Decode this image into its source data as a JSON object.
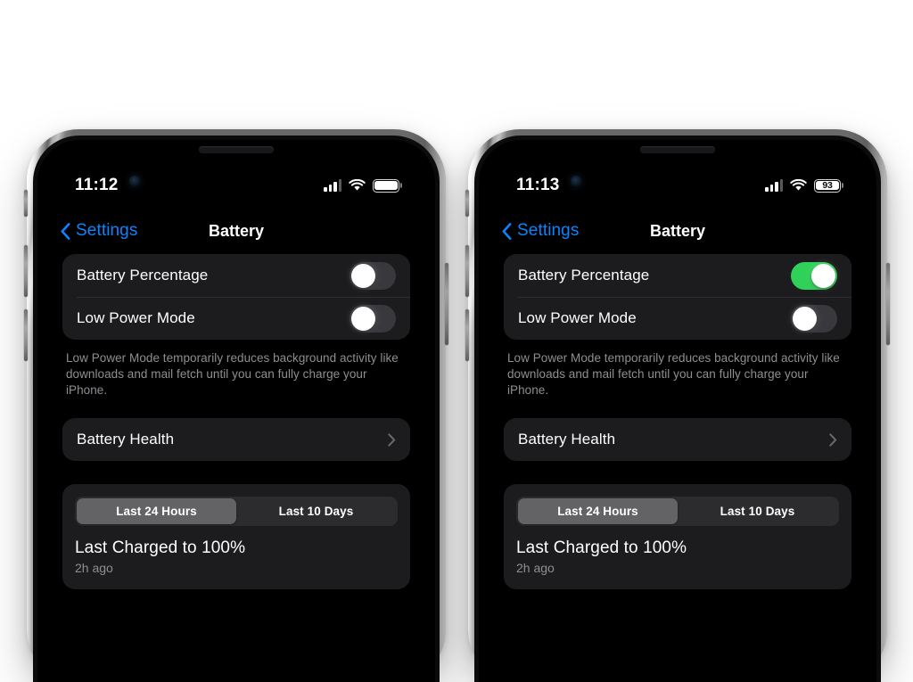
{
  "background_color": "#ffffff",
  "theme": {
    "screen_bg": "#000000",
    "card_bg": "#1c1c1e",
    "accent_blue": "#0a84ff",
    "toggle_on_green": "#30d158",
    "toggle_off_gray": "#39393d",
    "secondary_text": "#8e8e93",
    "segment_track": "#2c2c2e",
    "segment_selected": "#636366"
  },
  "phones": [
    {
      "id": "left",
      "status_bar": {
        "time": "11:12",
        "cellular_icon": "cellular-bars-icon",
        "wifi_icon": "wifi-icon",
        "battery_icon": "battery-icon",
        "battery_percentage_shown": false,
        "battery_percentage_text": ""
      },
      "nav": {
        "back_icon": "chevron-left-icon",
        "back_label": "Settings",
        "title": "Battery"
      },
      "settings_rows": [
        {
          "label": "Battery Percentage",
          "toggle": "off"
        },
        {
          "label": "Low Power Mode",
          "toggle": "off"
        }
      ],
      "footnote": "Low Power Mode temporarily reduces background activity like downloads and mail fetch until you can fully charge your iPhone.",
      "battery_health": {
        "label": "Battery Health",
        "disclosure_icon": "chevron-right-icon"
      },
      "usage_card": {
        "segments": [
          {
            "label": "Last 24 Hours",
            "selected": true
          },
          {
            "label": "Last 10 Days",
            "selected": false
          }
        ],
        "charge_title": "Last Charged to 100%",
        "charge_subtitle": "2h ago"
      }
    },
    {
      "id": "right",
      "status_bar": {
        "time": "11:13",
        "cellular_icon": "cellular-bars-icon",
        "wifi_icon": "wifi-icon",
        "battery_icon": "battery-icon",
        "battery_percentage_shown": true,
        "battery_percentage_text": "93"
      },
      "nav": {
        "back_icon": "chevron-left-icon",
        "back_label": "Settings",
        "title": "Battery"
      },
      "settings_rows": [
        {
          "label": "Battery Percentage",
          "toggle": "on"
        },
        {
          "label": "Low Power Mode",
          "toggle": "off"
        }
      ],
      "footnote": "Low Power Mode temporarily reduces background activity like downloads and mail fetch until you can fully charge your iPhone.",
      "battery_health": {
        "label": "Battery Health",
        "disclosure_icon": "chevron-right-icon"
      },
      "usage_card": {
        "segments": [
          {
            "label": "Last 24 Hours",
            "selected": true
          },
          {
            "label": "Last 10 Days",
            "selected": false
          }
        ],
        "charge_title": "Last Charged to 100%",
        "charge_subtitle": "2h ago"
      }
    }
  ]
}
